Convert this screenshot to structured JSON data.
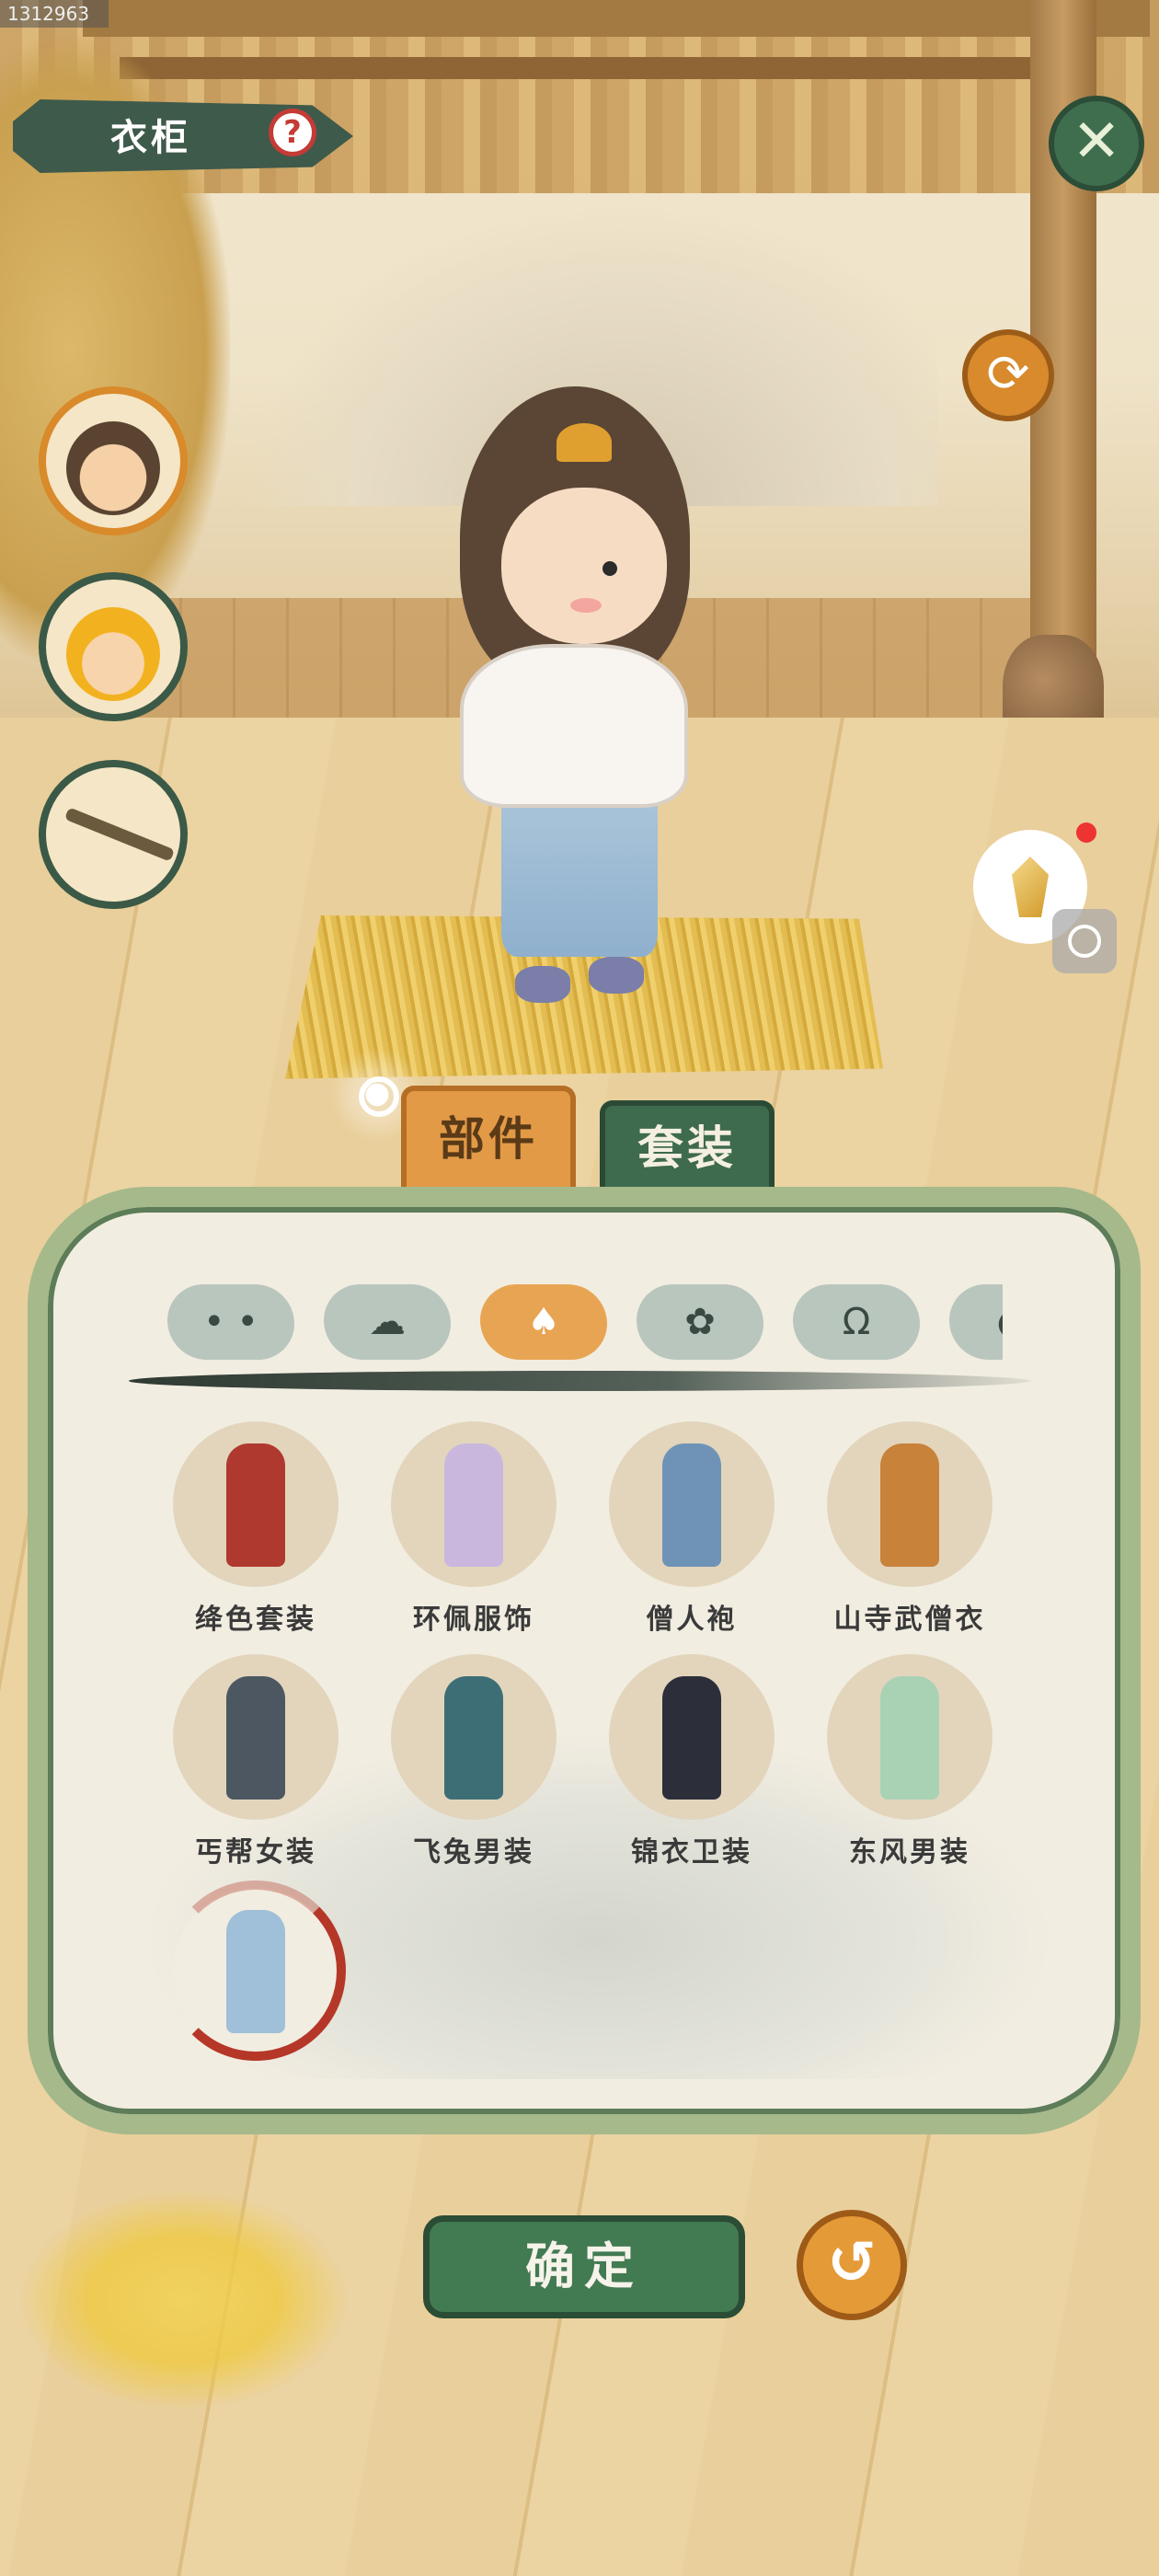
{
  "screen_id": "1312963",
  "header": {
    "title": "衣柜",
    "help_label": "?",
    "close_label": "✕",
    "refresh_label": "⟳"
  },
  "character_slots": [
    {
      "name": "hero-boy",
      "icon": "portrait-brown-hair",
      "active": true
    },
    {
      "name": "hero-blonde",
      "icon": "portrait-golden-hair",
      "active": false
    },
    {
      "name": "weapon",
      "icon": "sword-icon",
      "active": false
    }
  ],
  "tabs": [
    {
      "label": "部件",
      "active": true
    },
    {
      "label": "套装",
      "active": false
    }
  ],
  "categories": [
    {
      "icon": "face-icon",
      "glyph": "• •",
      "active": false
    },
    {
      "icon": "hair-icon",
      "glyph": "☁",
      "active": false
    },
    {
      "icon": "clothing-icon",
      "glyph": "♠",
      "active": true
    },
    {
      "icon": "flower-icon",
      "glyph": "✿",
      "active": false
    },
    {
      "icon": "pants-icon",
      "glyph": "Ω",
      "active": false
    },
    {
      "icon": "more-icon",
      "glyph": "◐",
      "active": false
    }
  ],
  "outfits": [
    {
      "label": "绛色套装",
      "color": "#b0392f"
    },
    {
      "label": "环佩服饰",
      "color": "#c9b7dd"
    },
    {
      "label": "僧人袍",
      "color": "#6f93b6"
    },
    {
      "label": "山寺武僧衣",
      "color": "#c8823a"
    },
    {
      "label": "丐帮女装",
      "color": "#4c5761"
    },
    {
      "label": "飞兔男装",
      "color": "#3d6e76"
    },
    {
      "label": "锦衣卫装",
      "color": "#2c2e3a"
    },
    {
      "label": "东风男装",
      "color": "#a9d2b5"
    },
    {
      "label": "",
      "color": "#9fc0d8",
      "selected": true
    }
  ],
  "footer": {
    "confirm_label": "确定",
    "back_label": "↺"
  },
  "colors": {
    "accent_green": "#3e6a4e",
    "accent_orange": "#e39a46",
    "selected_ring": "#b53728"
  }
}
